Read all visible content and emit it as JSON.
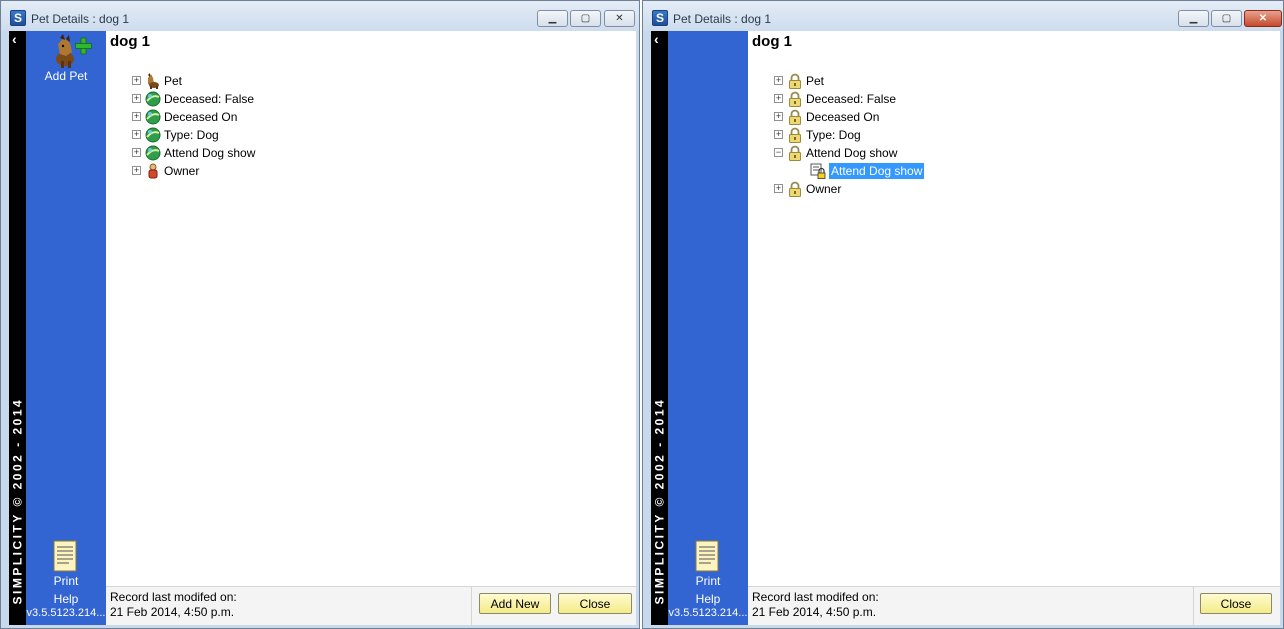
{
  "windows": {
    "left": {
      "title": "Pet Details : dog 1",
      "record_title": "dog 1",
      "sidebar": {
        "vertical_text": "SIMPLICITY © 2002 - 2014",
        "add_pet_label": "Add Pet",
        "print_label": "Print",
        "help_label": "Help",
        "version": "v3.5.5123.214..."
      },
      "tree": [
        {
          "label": "Pet",
          "icon": "dog-icon",
          "expanded": false
        },
        {
          "label": "Deceased:  False",
          "icon": "green-disc-icon",
          "expanded": false
        },
        {
          "label": "Deceased On",
          "icon": "green-disc-icon",
          "expanded": false
        },
        {
          "label": "Type:  Dog",
          "icon": "green-disc-icon",
          "expanded": false
        },
        {
          "label": "Attend Dog show",
          "icon": "green-disc-icon",
          "expanded": false
        },
        {
          "label": "Owner",
          "icon": "person-icon",
          "expanded": false
        }
      ],
      "footer": {
        "record_modified_label": "Record last modifed on:",
        "record_modified_date": "21 Feb 2014, 4:50 p.m.",
        "add_new_label": "Add New",
        "close_label": "Close"
      }
    },
    "right": {
      "title": "Pet Details : dog 1",
      "record_title": "dog 1",
      "sidebar": {
        "vertical_text": "SIMPLICITY © 2002 - 2014",
        "print_label": "Print",
        "help_label": "Help",
        "version": "v3.5.5123.214..."
      },
      "tree": [
        {
          "label": "Pet",
          "icon": "lock-icon",
          "expanded": false
        },
        {
          "label": "Deceased:  False",
          "icon": "lock-icon",
          "expanded": false
        },
        {
          "label": "Deceased On",
          "icon": "lock-icon",
          "expanded": false
        },
        {
          "label": "Type:  Dog",
          "icon": "lock-icon",
          "expanded": false
        },
        {
          "label": "Attend Dog show",
          "icon": "lock-icon",
          "expanded": true
        },
        {
          "label": "Attend Dog show",
          "icon": "locked-item-icon",
          "child": true,
          "selected": true
        },
        {
          "label": "Owner",
          "icon": "lock-icon",
          "expanded": false
        }
      ],
      "footer": {
        "record_modified_label": "Record last modifed on:",
        "record_modified_date": "21 Feb 2014, 4:50 p.m.",
        "close_label": "Close"
      }
    }
  },
  "colors": {
    "sidebar_blue": "#3265d2",
    "selection_blue": "#3399ff",
    "button_yellow": "#f4eb88"
  },
  "window_buttons": {
    "minimize": "minimize-icon",
    "maximize": "maximize-icon",
    "close": "close-icon"
  }
}
